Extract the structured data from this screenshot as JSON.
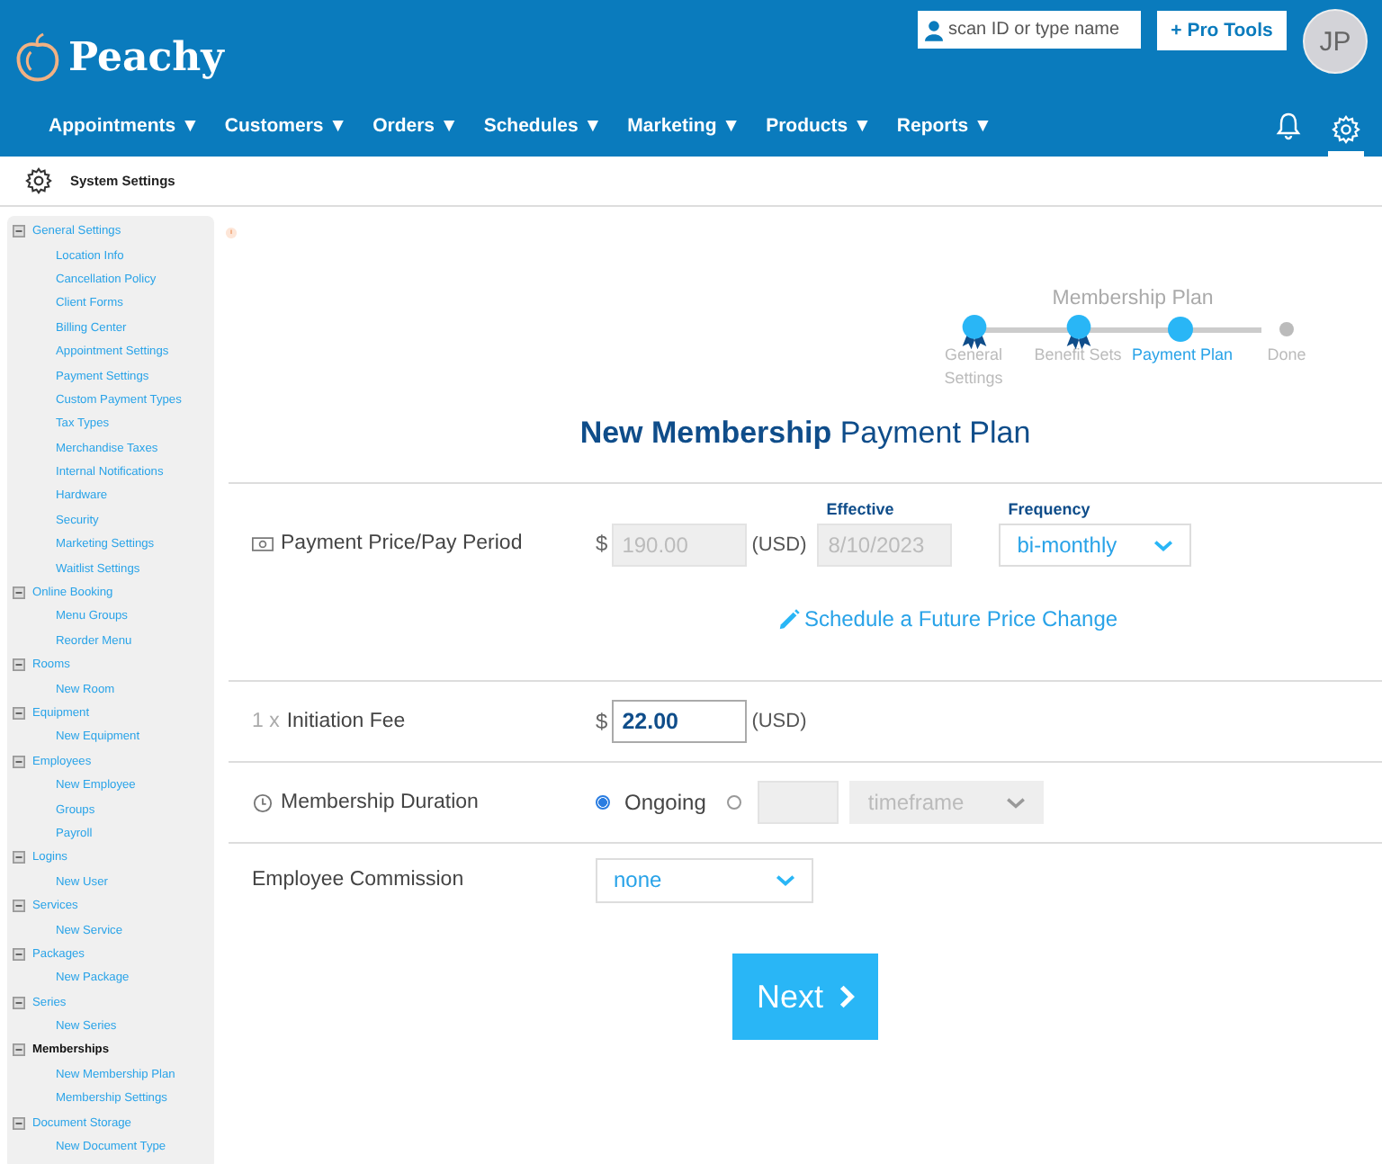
{
  "header": {
    "logo": "Peachy",
    "search": {
      "placeholder": "scan ID or type name"
    },
    "pro_tools": "+ Pro Tools",
    "avatar": "JP",
    "settings_selected": true,
    "nav": [
      {
        "label": "Appointments ▼"
      },
      {
        "label": "Customers ▼"
      },
      {
        "label": "Orders ▼"
      },
      {
        "label": "Schedules ▼"
      },
      {
        "label": "Marketing ▼"
      },
      {
        "label": "Products ▼"
      },
      {
        "label": "Reports ▼"
      }
    ]
  },
  "subheader": {
    "title": "System Settings"
  },
  "sidebar": {
    "items": [
      {
        "label": "General Settings",
        "selected": false,
        "children": [
          {
            "label": "Location Info",
            "selected": false
          },
          {
            "label": "Cancellation Policy",
            "selected": false
          },
          {
            "label": "Client Forms",
            "selected": false
          },
          {
            "label": "Billing Center",
            "selected": false
          },
          {
            "label": "Appointment Settings",
            "selected": false
          },
          {
            "label": "Payment Settings",
            "selected": false
          },
          {
            "label": "Custom Payment Types",
            "selected": false
          },
          {
            "label": "Tax Types",
            "selected": false
          },
          {
            "label": "Merchandise Taxes",
            "selected": false
          },
          {
            "label": "Internal Notifications",
            "selected": false
          },
          {
            "label": "Hardware",
            "selected": false
          },
          {
            "label": "Security",
            "selected": false
          },
          {
            "label": "Marketing Settings",
            "selected": false
          },
          {
            "label": "Waitlist Settings",
            "selected": false
          }
        ]
      },
      {
        "label": "Online Booking",
        "selected": false,
        "children": [
          {
            "label": "Menu Groups",
            "selected": false
          },
          {
            "label": "Reorder Menu",
            "selected": false
          }
        ]
      },
      {
        "label": "Rooms",
        "selected": false,
        "children": [
          {
            "label": "New Room",
            "selected": false
          }
        ]
      },
      {
        "label": "Equipment",
        "selected": false,
        "children": [
          {
            "label": "New Equipment",
            "selected": false
          }
        ]
      },
      {
        "label": "Employees",
        "selected": false,
        "children": [
          {
            "label": "New Employee",
            "selected": false
          },
          {
            "label": "Groups",
            "selected": false
          },
          {
            "label": "Payroll",
            "selected": false
          }
        ]
      },
      {
        "label": "Logins",
        "selected": false,
        "children": [
          {
            "label": "New User",
            "selected": false
          }
        ]
      },
      {
        "label": "Services",
        "selected": false,
        "children": [
          {
            "label": "New Service",
            "selected": false
          }
        ]
      },
      {
        "label": "Packages",
        "selected": false,
        "children": [
          {
            "label": "New Package",
            "selected": false
          }
        ]
      },
      {
        "label": "Series",
        "selected": false,
        "children": [
          {
            "label": "New Series",
            "selected": false
          }
        ]
      },
      {
        "label": "Memberships",
        "selected": true,
        "children": [
          {
            "label": "New Membership Plan",
            "selected": false
          },
          {
            "label": "Membership Settings",
            "selected": false
          }
        ]
      },
      {
        "label": "Document Storage",
        "selected": false,
        "children": [
          {
            "label": "New Document Type",
            "selected": false
          }
        ]
      }
    ]
  },
  "stepper": {
    "title": "Membership Plan",
    "steps": [
      {
        "label": "General Settings",
        "completed": true,
        "selected": false
      },
      {
        "label": "Benefit Sets",
        "completed": true,
        "selected": false
      },
      {
        "label": "Payment Plan",
        "completed": false,
        "selected": true
      },
      {
        "label": "Done",
        "completed": false,
        "selected": false
      }
    ]
  },
  "form": {
    "title": "**New Membership** Payment Plan",
    "price": {
      "label": "Payment Price/Pay Period",
      "currency": "$",
      "value": "190.00",
      "disabled": true,
      "unit": "(USD)",
      "effective_label": "Effective",
      "effective": "8/10/2023",
      "effective_disabled": true,
      "frequency_label": "Frequency",
      "frequency": "bi-monthly",
      "link": "Schedule a Future Price Change"
    },
    "initiation": {
      "prefix": "1 x",
      "label": "Initiation Fee",
      "currency": "$",
      "value": "22.00",
      "unit": "(USD)"
    },
    "duration": {
      "label": "Membership Duration",
      "options": [
        {
          "label": "Ongoing",
          "selected": true
        },
        {
          "selected": false
        }
      ],
      "timeframe": "timeframe",
      "timeframe_disabled": true
    },
    "commission": {
      "label": "Employee Commission",
      "value": "none"
    },
    "next": "Next"
  }
}
